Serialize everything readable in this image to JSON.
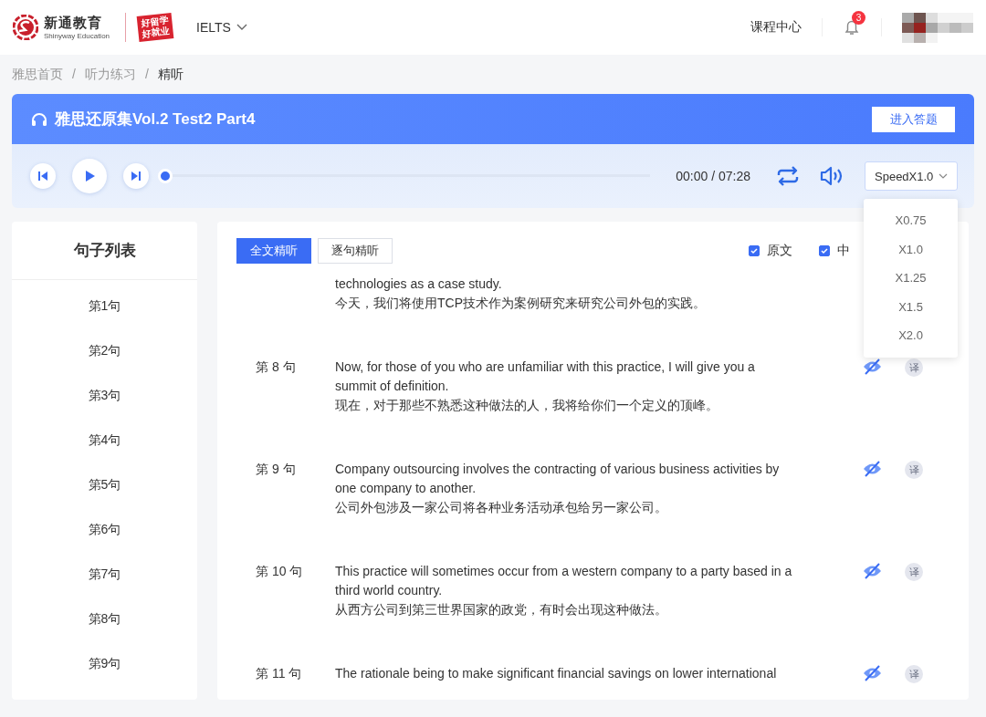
{
  "header": {
    "logo_name": "新通教育",
    "logo_subtitle": "Shinyway Education",
    "badge_lines": [
      "好留学",
      "好就业"
    ],
    "exam": "IELTS",
    "nav_link": "课程中心",
    "notifications": "3"
  },
  "breadcrumb": {
    "separator": "/",
    "items": [
      {
        "label": "雅思首页",
        "current": false
      },
      {
        "label": "听力练习",
        "current": false
      },
      {
        "label": "精听",
        "current": true
      }
    ]
  },
  "player": {
    "title": "雅思还原集Vol.2 Test2 Part4",
    "enter_button": "进入答题",
    "level": 0,
    "time": "00:00 / 07:28",
    "speed": "SpeedX1.0",
    "speed_expanded": true,
    "speed_options": [
      {
        "label": "X0.75",
        "selected": false
      },
      {
        "label": "X1.0",
        "selected": false
      },
      {
        "label": "X1.25",
        "selected": false
      },
      {
        "label": "X1.5",
        "selected": false
      },
      {
        "label": "X2.0",
        "selected": false
      }
    ]
  },
  "sidebar": {
    "title": "句子列表",
    "items": [
      {
        "label": "第1句",
        "selected": false
      },
      {
        "label": "第2句",
        "selected": false
      },
      {
        "label": "第3句",
        "selected": false
      },
      {
        "label": "第4句",
        "selected": false
      },
      {
        "label": "第5句",
        "selected": false
      },
      {
        "label": "第6句",
        "selected": false
      },
      {
        "label": "第7句",
        "selected": false
      },
      {
        "label": "第8句",
        "selected": false
      },
      {
        "label": "第9句",
        "selected": false
      }
    ]
  },
  "transcript": {
    "tabs": [
      {
        "label": "全文精听",
        "selected": true
      },
      {
        "label": "逐句精听",
        "selected": false
      }
    ],
    "toggles": [
      {
        "label": "原文",
        "checked": true
      },
      {
        "label": "中",
        "checked": true
      }
    ],
    "sentences": [
      {
        "english": "technologies as a case study.",
        "chinese": "今天，我们将使用TCP技术作为案例研究来研究公司外包的实践。"
      },
      {
        "label": "第 8 句",
        "english": "Now, for those of you who are unfamiliar with this practice, I will give you a summit of definition.",
        "chinese": "现在，对于那些不熟悉这种做法的人，我将给你们一个定义的顶峰。",
        "translate": "译"
      },
      {
        "label": "第 9 句",
        "english": "Company outsourcing involves the contracting of various business activities by one company to another.",
        "chinese": "公司外包涉及一家公司将各种业务活动承包给另一家公司。",
        "translate": "译"
      },
      {
        "label": "第 10 句",
        "english": "This practice will sometimes occur from a western company to a party based in a third world country.",
        "chinese": "从西方公司到第三世界国家的政党，有时会出现这种做法。",
        "translate": "译"
      },
      {
        "label": "第 11 句",
        "english": "The rationale being to make significant financial savings on lower international",
        "translate": "译"
      }
    ]
  }
}
